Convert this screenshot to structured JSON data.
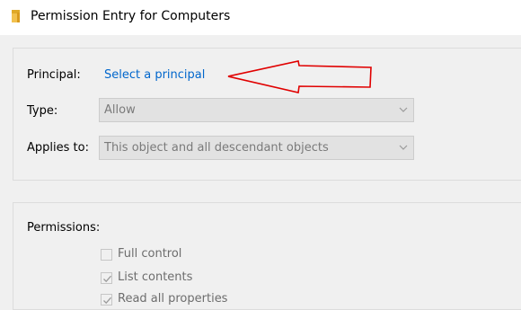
{
  "window": {
    "title": "Permission Entry for Computers",
    "icon": "folder-icon"
  },
  "principal": {
    "label": "Principal:",
    "link_text": "Select a principal"
  },
  "type": {
    "label": "Type:",
    "value": "Allow"
  },
  "applies_to": {
    "label": "Applies to:",
    "value": "This object and all descendant objects"
  },
  "permissions": {
    "label": "Permissions:",
    "items": [
      {
        "label": "Full control",
        "checked": false
      },
      {
        "label": "List contents",
        "checked": true
      },
      {
        "label": "Read all properties",
        "checked": true
      }
    ]
  },
  "annotation": {
    "arrow_color": "#e00000"
  },
  "colors": {
    "link": "#0066cc",
    "disabled_text": "#7a7a7a"
  }
}
